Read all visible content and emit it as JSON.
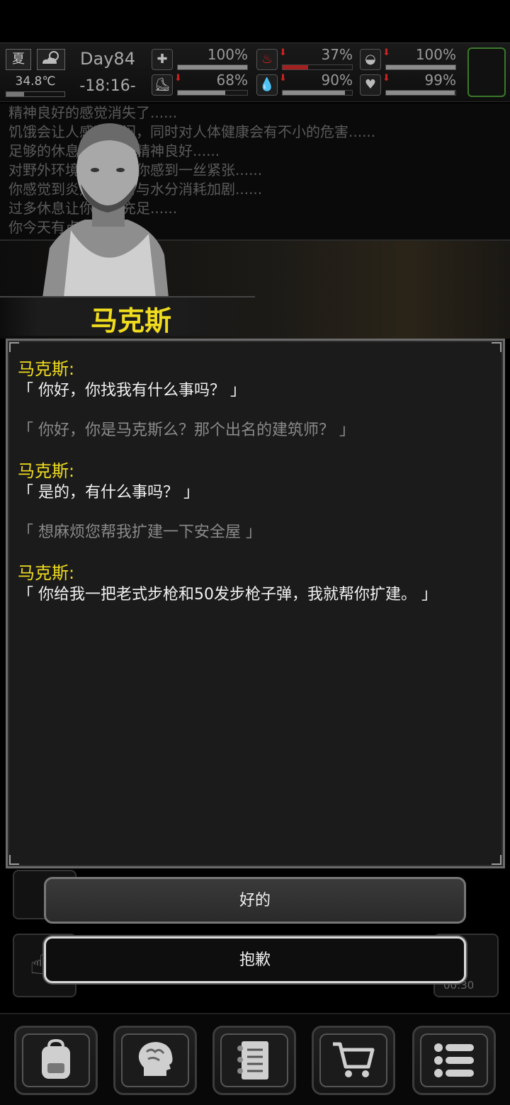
{
  "status": {
    "season": "夏",
    "temperature": "34.8℃",
    "day": "Day84",
    "time": "-18:16-",
    "stats": [
      {
        "icon": "first-aid-icon",
        "value": 1.0,
        "label": "100%",
        "declining": false
      },
      {
        "icon": "stomach-icon",
        "value": 0.37,
        "label": "37%",
        "declining": true
      },
      {
        "icon": "pill-icon",
        "value": 1.0,
        "label": "100%",
        "declining": true
      },
      {
        "icon": "boot-icon",
        "value": 0.68,
        "label": "68%",
        "declining": true
      },
      {
        "icon": "water-drop-icon",
        "value": 0.9,
        "label": "90%",
        "declining": true
      },
      {
        "icon": "heart-icon",
        "value": 0.99,
        "label": "99%",
        "declining": true
      }
    ]
  },
  "log": [
    "精神良好的感觉消失了......",
    "饥饿会让人感到烦闷，同时对人体健康会有不小的危害......",
    "足够的休息让你感到精神良好......",
    "对野外环境的恐惧让你感到一丝紧张......",
    "你感觉到炎热让体力与水分消耗加剧......",
    "过多休息让你精神充足......",
    "你今天有点饿了......"
  ],
  "npc": {
    "name": "马克斯"
  },
  "dialogue": [
    {
      "speaker": "马克斯:",
      "text": "「 你好，你找我有什么事吗？ 」"
    },
    {
      "player": "「 你好，你是马克斯么？那个出名的建筑师？ 」"
    },
    {
      "speaker": "马克斯:",
      "text": "「 是的，有什么事吗？ 」"
    },
    {
      "player": "「 想麻烦您帮我扩建一下安全屋 」"
    },
    {
      "speaker": "马克斯:",
      "text": "「 你给我一把老式步枪和50发步枪子弹，我就帮你扩建。 」"
    }
  ],
  "choices": {
    "accept": "好的",
    "decline": "抱歉"
  },
  "timer": "00:30",
  "nav": [
    "backpack-icon",
    "brain-icon",
    "journal-icon",
    "cart-icon",
    "menu-icon"
  ],
  "colors": {
    "speaker": "#f0dc1e",
    "accent_green": "#3a7a2a",
    "declining": "#cc2222"
  }
}
